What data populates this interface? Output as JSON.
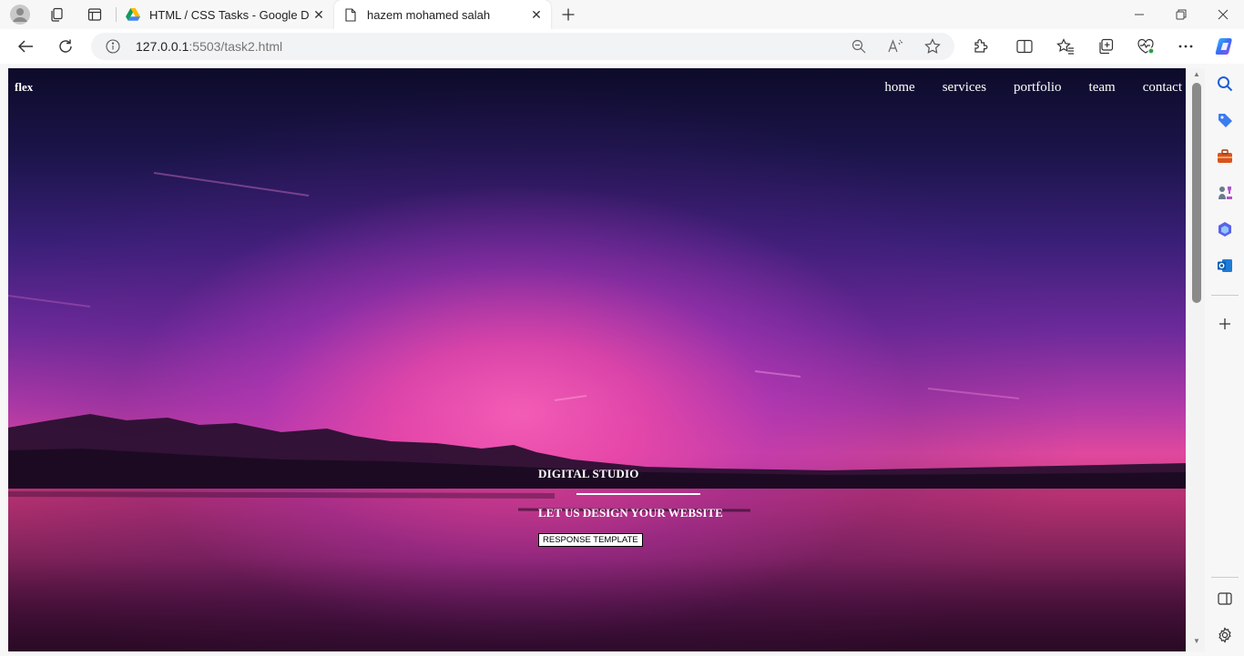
{
  "browser": {
    "tabs": [
      {
        "title": "HTML / CSS Tasks - Google Drive",
        "icon": "google-drive-icon"
      },
      {
        "title": "hazem mohamed salah",
        "icon": "file-icon"
      }
    ],
    "url_host": "127.0.0.1",
    "url_rest": ":5503/task2.html"
  },
  "page": {
    "logo": "flex",
    "nav": [
      "home",
      "services",
      "portfolio",
      "team",
      "contact"
    ],
    "hero": {
      "title": "DIGITAL STUDIO",
      "subtitle": "LET US DESIGN YOUR WEBSITE",
      "button": "RESPONSE TEMPLATE"
    }
  },
  "colors": {
    "accent_pink": "#f35cb5",
    "sky_top": "#0d0b2a",
    "sky_purple": "#6d2a9a"
  }
}
